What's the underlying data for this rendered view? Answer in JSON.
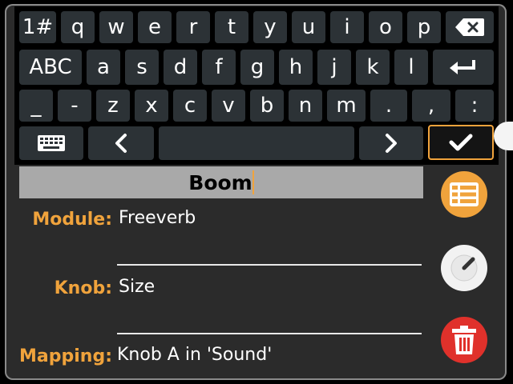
{
  "keyboard": {
    "row1": [
      "1#",
      "q",
      "w",
      "e",
      "r",
      "t",
      "y",
      "u",
      "i",
      "o",
      "p"
    ],
    "row2": [
      "ABC",
      "a",
      "s",
      "d",
      "f",
      "g",
      "h",
      "j",
      "k",
      "l"
    ],
    "row3": [
      "_",
      "-",
      "z",
      "x",
      "c",
      "v",
      "b",
      "n",
      "m",
      ".",
      ",",
      ":"
    ],
    "icons": {
      "backspace": "backspace-icon",
      "enter": "enter-icon",
      "keyboard": "keyboard-icon",
      "left": "chevron-left-icon",
      "right": "chevron-right-icon",
      "confirm": "check-icon"
    }
  },
  "edit_field": {
    "value": "Boom"
  },
  "form": {
    "module_label": "Module:",
    "module_value": "Freeverb",
    "knob_label": "Knob:",
    "knob_value": "Size",
    "mapping_label": "Mapping:",
    "mapping_value": "Knob A in 'Sound'"
  },
  "side_buttons": {
    "list": "list-icon",
    "knob": "knob-icon",
    "delete": "trash-icon"
  },
  "colors": {
    "accent": "#f0a33c",
    "key_bg": "#2c3236",
    "delete": "#e0312b",
    "panel": "#2b2b2b"
  }
}
